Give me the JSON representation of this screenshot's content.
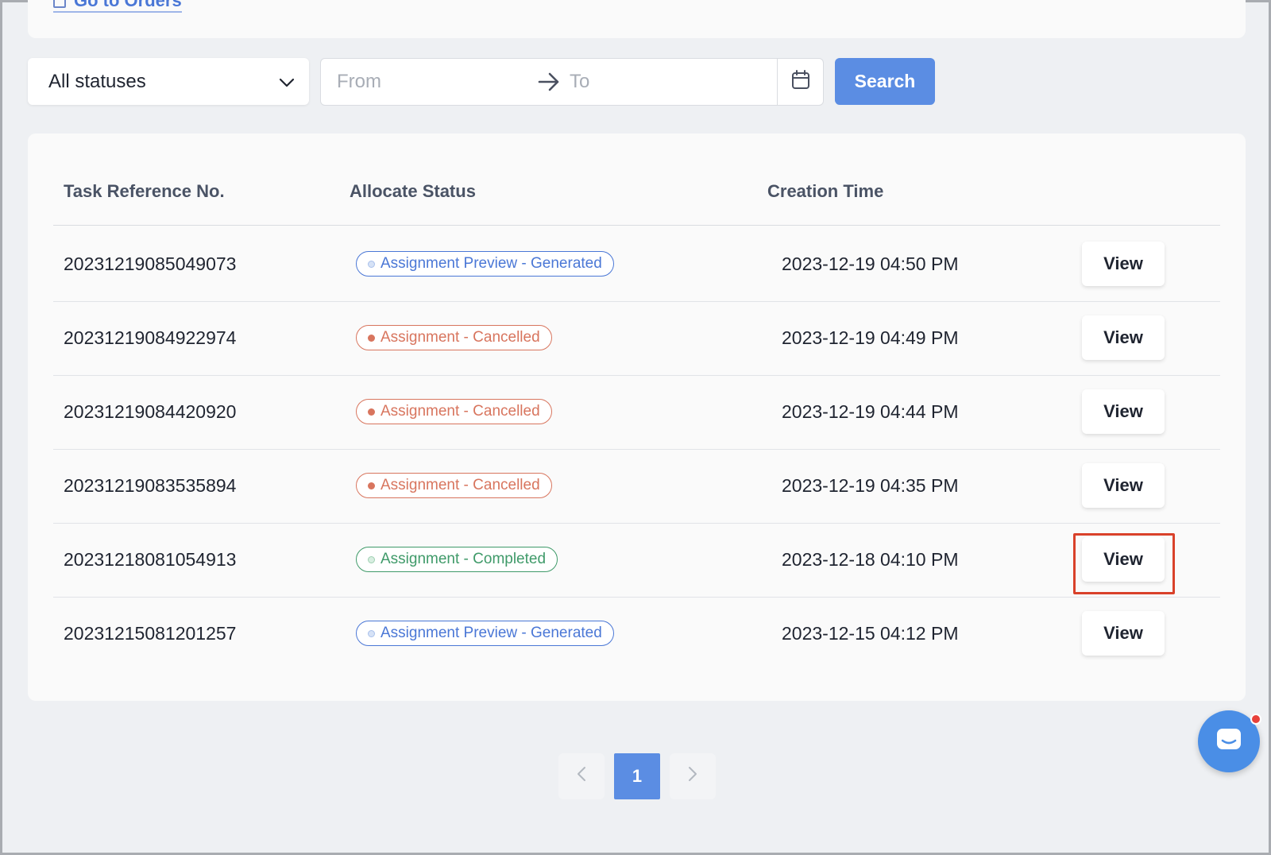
{
  "top": {
    "go_to_orders_label": "Go to Orders"
  },
  "filters": {
    "status_selected": "All statuses",
    "date_from_placeholder": "From",
    "date_to_placeholder": "To",
    "search_label": "Search"
  },
  "table": {
    "headers": [
      "Task Reference No.",
      "Allocate Status",
      "Creation Time"
    ],
    "rows": [
      {
        "ref": "20231219085049073",
        "status": "Assignment Preview - Generated",
        "status_color": "#4a77d6",
        "time": "2023-12-19 04:50 PM",
        "action": "View"
      },
      {
        "ref": "20231219084922974",
        "status": "Assignment - Cancelled",
        "status_color": "#d8755e",
        "time": "2023-12-19 04:49 PM",
        "action": "View"
      },
      {
        "ref": "20231219084420920",
        "status": "Assignment - Cancelled",
        "status_color": "#d8755e",
        "time": "2023-12-19 04:44 PM",
        "action": "View"
      },
      {
        "ref": "20231219083535894",
        "status": "Assignment - Cancelled",
        "status_color": "#d8755e",
        "time": "2023-12-19 04:35 PM",
        "action": "View"
      },
      {
        "ref": "20231218081054913",
        "status": "Assignment - Completed",
        "status_color": "#3f9a69",
        "time": "2023-12-18 04:10 PM",
        "action": "View"
      },
      {
        "ref": "20231215081201257",
        "status": "Assignment Preview - Generated",
        "status_color": "#4a77d6",
        "time": "2023-12-15 04:12 PM",
        "action": "View"
      }
    ]
  },
  "pagination": {
    "current_page": "1"
  },
  "icons": {
    "select": "chevron-down-icon",
    "range": "arrow-right-icon",
    "calendar": "calendar-icon",
    "prev": "chevron-left-icon",
    "next": "chevron-right-icon",
    "chat": "chat-icon"
  },
  "colors": {
    "primary": "#5b8de3",
    "highlight": "#d9412a",
    "notification": "#e8413a"
  }
}
